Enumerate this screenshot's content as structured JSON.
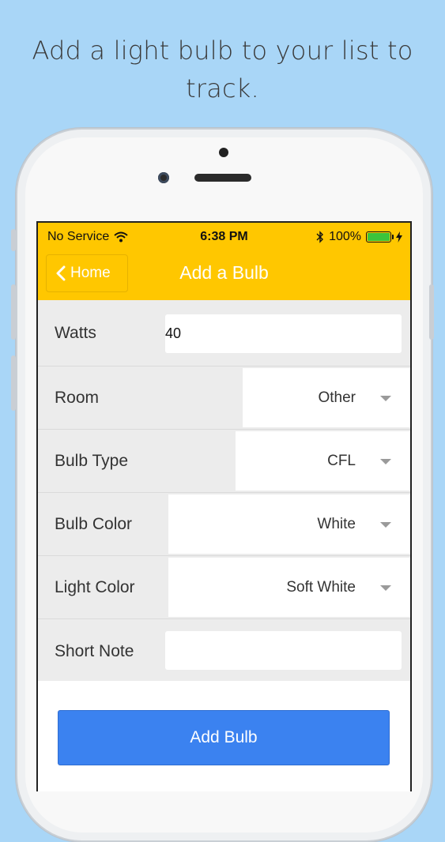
{
  "promo": {
    "line1": "Add a light bulb to your list to",
    "line2": "track."
  },
  "status_bar": {
    "carrier": "No Service",
    "time": "6:38 PM",
    "battery": "100%",
    "battery_level": 1.0
  },
  "nav": {
    "back_label": "Home",
    "title": "Add a Bulb"
  },
  "form": {
    "watts": {
      "label": "Watts",
      "value": "40"
    },
    "room": {
      "label": "Room",
      "value": "Other"
    },
    "bulb_type": {
      "label": "Bulb Type",
      "value": "CFL"
    },
    "bulb_color": {
      "label": "Bulb Color",
      "value": "White"
    },
    "light_color": {
      "label": "Light Color",
      "value": "Soft White"
    },
    "short_note": {
      "label": "Short Note",
      "value": ""
    }
  },
  "actions": {
    "add_label": "Add Bulb"
  },
  "colors": {
    "header": "#ffc700",
    "button": "#3b82f0",
    "background": "#a9d6f7",
    "battery_fill": "#3bc43b"
  },
  "icons": [
    "wifi-icon",
    "bluetooth-icon",
    "battery-icon",
    "charging-icon",
    "chevron-left-icon",
    "dropdown-caret-icon"
  ]
}
